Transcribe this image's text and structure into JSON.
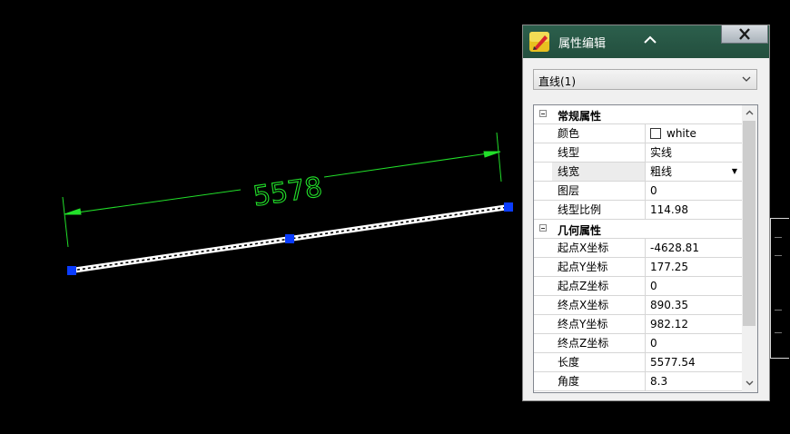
{
  "drawing": {
    "dimension_text": "5578"
  },
  "panel": {
    "title": "属性编辑",
    "close_glyph": "X",
    "entity_selector": {
      "value": "直线(1)"
    },
    "categories": [
      {
        "label": "常规属性"
      },
      {
        "label": "几何属性"
      }
    ],
    "properties": [
      {
        "name": "颜色",
        "value": "white"
      },
      {
        "name": "线型",
        "value": "实线"
      },
      {
        "name": "线宽",
        "value": "粗线"
      },
      {
        "name": "图层",
        "value": "0"
      },
      {
        "name": "线型比例",
        "value": "114.98"
      },
      {
        "name": "起点X坐标",
        "value": "-4628.81"
      },
      {
        "name": "起点Y坐标",
        "value": "177.25"
      },
      {
        "name": "起点Z坐标",
        "value": "0"
      },
      {
        "name": "终点X坐标",
        "value": "890.35"
      },
      {
        "name": "终点Y坐标",
        "value": "982.12"
      },
      {
        "name": "终点Z坐标",
        "value": "0"
      },
      {
        "name": "长度",
        "value": "5577.54"
      },
      {
        "name": "角度",
        "value": "8.3"
      }
    ]
  },
  "colors": {
    "dimension": "#22e02a",
    "grip": "#0a3cff",
    "header": "#2c5f4c"
  },
  "icons": [
    "app-pencil-icon",
    "collapse-up-icon",
    "close-icon",
    "chevron-down-icon",
    "expander-minus-icon"
  ]
}
